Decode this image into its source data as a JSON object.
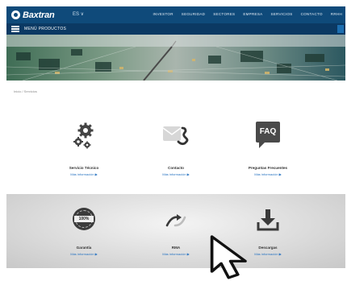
{
  "header": {
    "brand": "Baxtran",
    "lang": "ES ∨",
    "nav": [
      "INVESTOR",
      "SEGURIDAD",
      "SECTORES",
      "EMPRESA",
      "SERVICIOS",
      "CONTACTO",
      "RRHH"
    ]
  },
  "subnav": {
    "menu_label": "MENÚ PRODUCTOS"
  },
  "breadcrumb": "Inicio / Servicios",
  "services": [
    {
      "title": "Servicio Técnico",
      "link": "Más información ▶"
    },
    {
      "title": "Contacto",
      "link": "Más información ▶"
    },
    {
      "title": "Preguntas Frecuentes",
      "link": "Más información ▶"
    },
    {
      "title": "Garantía",
      "link": "Más información ▶"
    },
    {
      "title": "RMA",
      "link": "Más información ▶"
    },
    {
      "title": "Descargas",
      "link": "Más información ▶"
    }
  ],
  "faq_icon_text": "FAQ",
  "warranty_badge_text": "100%",
  "colors": {
    "topbar": "#0f4a7a",
    "subbar": "#0b3963",
    "link": "#2a75c2"
  }
}
